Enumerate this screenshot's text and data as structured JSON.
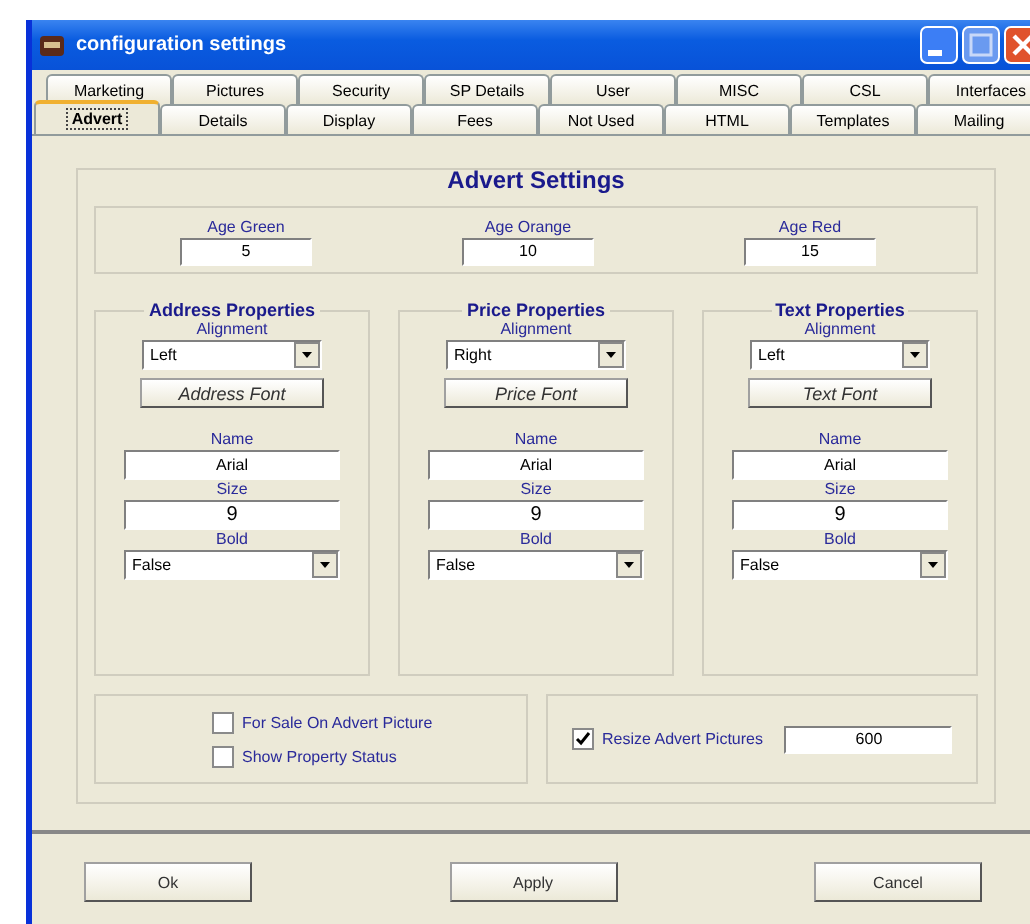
{
  "window": {
    "title": "configuration settings"
  },
  "tab_rows": [
    [
      {
        "label": "Marketing",
        "selected": false
      },
      {
        "label": "Pictures",
        "selected": false
      },
      {
        "label": "Security",
        "selected": false
      },
      {
        "label": "SP Details",
        "selected": false
      },
      {
        "label": "User",
        "selected": false
      },
      {
        "label": "MISC",
        "selected": false
      },
      {
        "label": "CSL",
        "selected": false
      },
      {
        "label": "Interfaces",
        "selected": false
      }
    ],
    [
      {
        "label": "Advert",
        "selected": true
      },
      {
        "label": "Details",
        "selected": false
      },
      {
        "label": "Display",
        "selected": false
      },
      {
        "label": "Fees",
        "selected": false
      },
      {
        "label": "Not Used",
        "selected": false
      },
      {
        "label": "HTML",
        "selected": false
      },
      {
        "label": "Templates",
        "selected": false
      },
      {
        "label": "Mailing",
        "selected": false
      }
    ]
  ],
  "panel": {
    "title": "Advert Settings",
    "ages": [
      {
        "label": "Age Green",
        "value": "5"
      },
      {
        "label": "Age Orange",
        "value": "10"
      },
      {
        "label": "Age Red",
        "value": "15"
      }
    ],
    "groups": [
      {
        "title": "Address Properties",
        "alignment_label": "Alignment",
        "alignment": "Left",
        "font_button": "Address Font",
        "name_label": "Name",
        "name": "Arial",
        "size_label": "Size",
        "size": "9",
        "bold_label": "Bold",
        "bold": "False"
      },
      {
        "title": "Price Properties",
        "alignment_label": "Alignment",
        "alignment": "Right",
        "font_button": "Price Font",
        "name_label": "Name",
        "name": "Arial",
        "size_label": "Size",
        "size": "9",
        "bold_label": "Bold",
        "bold": "False"
      },
      {
        "title": "Text Properties",
        "alignment_label": "Alignment",
        "alignment": "Left",
        "font_button": "Text Font",
        "name_label": "Name",
        "name": "Arial",
        "size_label": "Size",
        "size": "9",
        "bold_label": "Bold",
        "bold": "False"
      }
    ],
    "options": [
      {
        "label": "For Sale On Advert Picture",
        "checked": false
      },
      {
        "label": "Show Property Status",
        "checked": false
      }
    ],
    "resize": {
      "label": "Resize Advert Pictures",
      "checked": true,
      "value": "600"
    }
  },
  "buttons": [
    "Ok",
    "Apply",
    "Cancel"
  ]
}
